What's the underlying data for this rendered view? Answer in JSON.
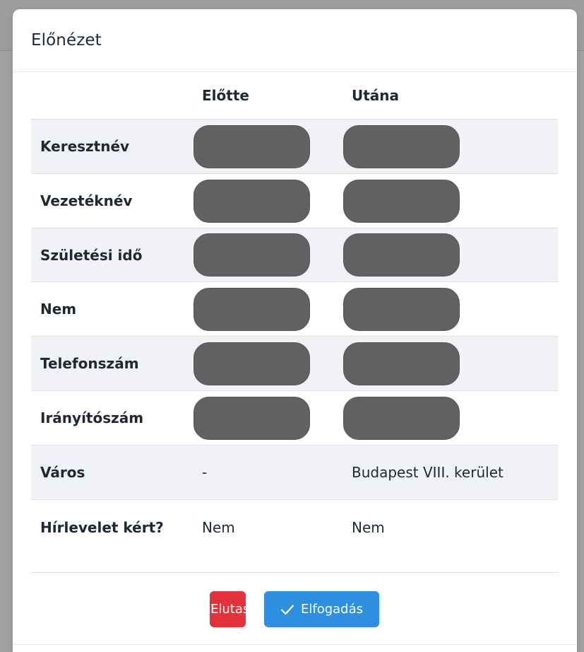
{
  "modal": {
    "title": "Előnézet"
  },
  "table": {
    "headers": {
      "label": "",
      "before": "Előtte",
      "after": "Utána"
    },
    "rows": [
      {
        "label": "Keresztnév",
        "before": "",
        "after": "",
        "redacted": true
      },
      {
        "label": "Vezetéknév",
        "before": "",
        "after": "",
        "redacted": true
      },
      {
        "label": "Születési idő",
        "before": "",
        "after": "",
        "redacted": true
      },
      {
        "label": "Nem",
        "before": "",
        "after": "",
        "redacted": true
      },
      {
        "label": "Telefonszám",
        "before": "",
        "after": "",
        "redacted": true
      },
      {
        "label": "Irányítószám",
        "before": "",
        "after": "",
        "redacted": true
      },
      {
        "label": "Város",
        "before": "-",
        "after": "Budapest VIII. kerület",
        "redacted": false
      },
      {
        "label": "Hírlevelet kért?",
        "before": "Nem",
        "after": "Nem",
        "redacted": false
      }
    ]
  },
  "actions": {
    "reject_label": "Elutasítás",
    "accept_label": "Elfogadás"
  },
  "colors": {
    "reject": "#e2323c",
    "accept": "#2e8fe0",
    "redaction": "#616161",
    "stripe": "#f0f2f7"
  },
  "icons": {
    "accept": "check-icon"
  }
}
